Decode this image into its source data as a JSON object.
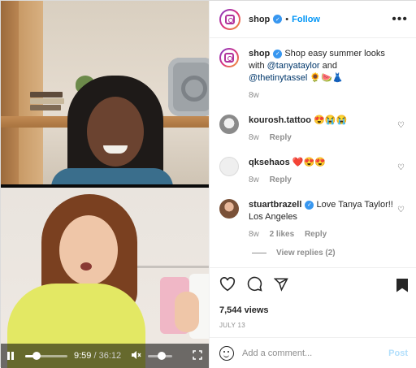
{
  "video": {
    "current_time": "9:59",
    "separator": "/",
    "duration": "36:12",
    "progress_fraction": 0.276,
    "volume_fraction": 0.55,
    "icons": {
      "pause": "pause-icon",
      "mute": "volume-mute-icon",
      "fullscreen": "fullscreen-icon"
    }
  },
  "header": {
    "username": "shop",
    "dot": "•",
    "follow_label": "Follow",
    "more_label": "•••"
  },
  "caption": {
    "username": "shop",
    "text_before": "Shop easy summer looks with",
    "mention1": "@tanyataylor",
    "text_and": "and",
    "mention2": "@thetinytassel",
    "emojis": "🌻🍉👗",
    "age": "8w"
  },
  "comments": [
    {
      "username": "kourosh.tattoo",
      "text": "😍😭😭",
      "age": "8w",
      "reply_label": "Reply"
    },
    {
      "username": "qksehaos",
      "text": "❤️😍😍",
      "age": "8w",
      "reply_label": "Reply"
    },
    {
      "username": "stuartbrazell",
      "text": "Love Tanya Taylor!! Los Angeles",
      "age": "8w",
      "likes": "2 likes",
      "reply_label": "Reply",
      "view_replies": "View replies (2)"
    }
  ],
  "actions": {
    "views": "7,544 views",
    "date": "JULY 13"
  },
  "composer": {
    "placeholder": "Add a comment...",
    "post_label": "Post"
  },
  "colors": {
    "accent_blue": "#0095f6",
    "post_disabled": "#b2dffc",
    "muted": "#8e8e8e"
  }
}
